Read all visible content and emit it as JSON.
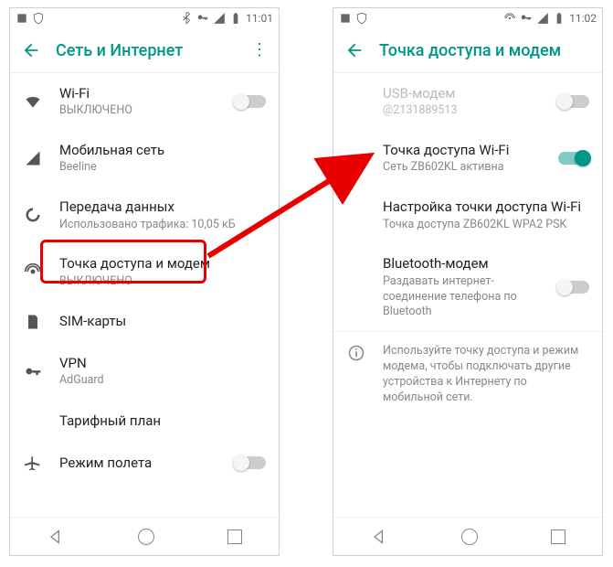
{
  "left": {
    "time": "11:01",
    "title": "Сеть и Интернет",
    "items": [
      {
        "id": "wifi",
        "label": "Wi-Fi",
        "sub": "ВЫКЛЮЧЕНО",
        "toggle": false
      },
      {
        "id": "mobile",
        "label": "Мобильная сеть",
        "sub": "Beeline"
      },
      {
        "id": "data",
        "label": "Передача данных",
        "sub": "Использовано трафика: 10,05 кБ"
      },
      {
        "id": "tether",
        "label": "Точка доступа и модем",
        "sub": "ВЫКЛЮЧЕНО"
      },
      {
        "id": "sim",
        "label": "SIM-карты",
        "sub": ""
      },
      {
        "id": "vpn",
        "label": "VPN",
        "sub": "AdGuard"
      },
      {
        "id": "plan",
        "label": "Тарифный план",
        "sub": ""
      },
      {
        "id": "air",
        "label": "Режим полета",
        "sub": "",
        "toggle": false
      }
    ]
  },
  "right": {
    "time": "11:02",
    "title": "Точка доступа и модем",
    "items": [
      {
        "id": "usb",
        "label": "USB-модем",
        "sub": "@2131889513",
        "toggle": false,
        "disabled": true
      },
      {
        "id": "wifi",
        "label": "Точка доступа Wi-Fi",
        "sub": "Сеть ZB602KL активна",
        "toggle": true
      },
      {
        "id": "cfg",
        "label": "Настройка точки доступа Wi-Fi",
        "sub": "Точка доступа ZB602KL WPA2 PSK"
      },
      {
        "id": "bt",
        "label": "Bluetooth-модем",
        "sub": "Раздавать интернет-соединение телефона по Bluetooth",
        "toggle": false
      }
    ],
    "info": "Используйте точку доступа и режим модема, чтобы подключать другие устройства к Интернету по мобильной сети."
  }
}
